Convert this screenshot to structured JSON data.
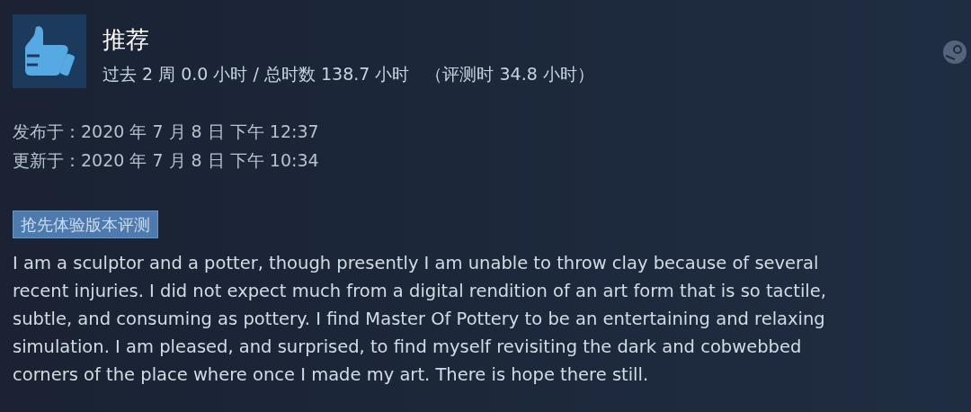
{
  "header": {
    "title": "推荐",
    "playtime": "过去 2 周 0.0 小时 / 总时数 138.7 小时",
    "review_time": "（评测时 34.8 小时）"
  },
  "dates": [
    "发布于：2020 年 7 月 8 日 下午 12:37",
    "更新于：2020 年 7 月 8 日 下午 10:34"
  ],
  "badge": "抢先体验版本评测",
  "review_lines": [
    "I am a sculptor and a potter, though presently I am unable to throw clay because of several",
    "recent injuries. I did not expect much from a digital rendition of an art form that is so tactile,",
    "subtle, and consuming as pottery. I find Master Of Pottery to be an entertaining and relaxing",
    "simulation. I am pleased, and surprised, to find myself revisiting the dark and cobwebbed",
    "corners of the place where once I made my art. There is hope there still."
  ]
}
